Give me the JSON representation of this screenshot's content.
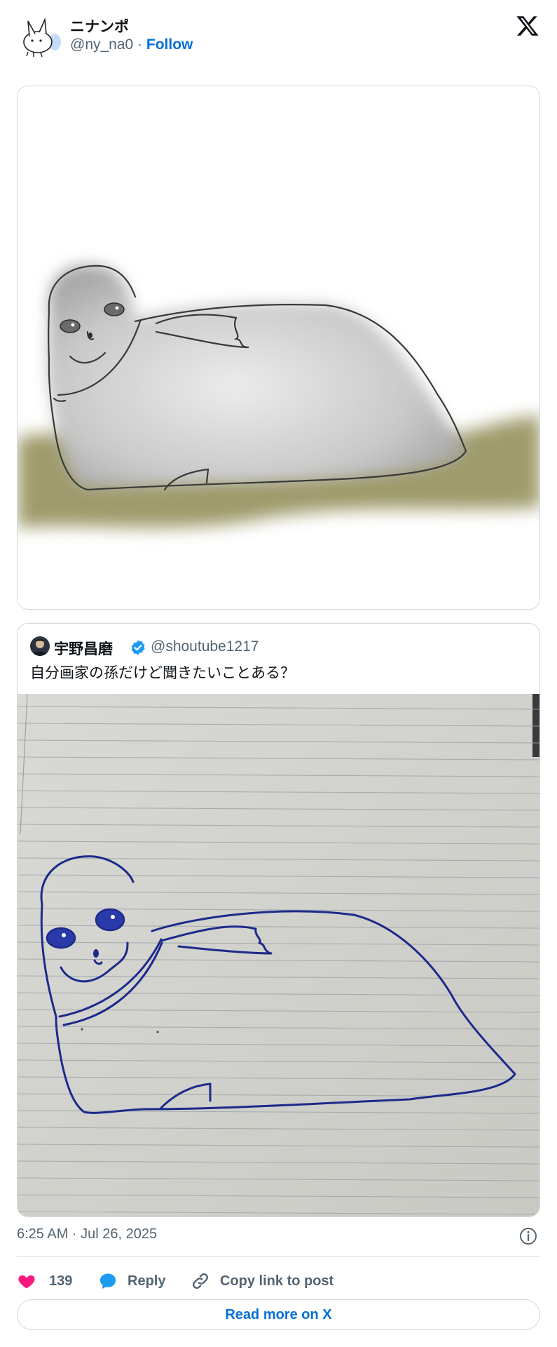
{
  "author": {
    "name": "ニナンポ",
    "handle": "@ny_na0",
    "separator": " · ",
    "follow_label": "Follow"
  },
  "main_media": {
    "alt": "seal drawing painted"
  },
  "quoted_tweet": {
    "name": "宇野昌磨",
    "handle": "@shoutube1217",
    "text": "自分画家の孫だけど聞きたいことある？",
    "verified": true
  },
  "timestamp": "6:25 AM · Jul 26, 2025",
  "actions": {
    "like_count": "139",
    "reply_label": "Reply",
    "copy_label": "Copy link to post"
  },
  "read_more_label": "Read more on X",
  "colors": {
    "accent": "#006fd6",
    "like": "#f91880",
    "reply": "#1d9bf0",
    "muted": "#536471"
  }
}
